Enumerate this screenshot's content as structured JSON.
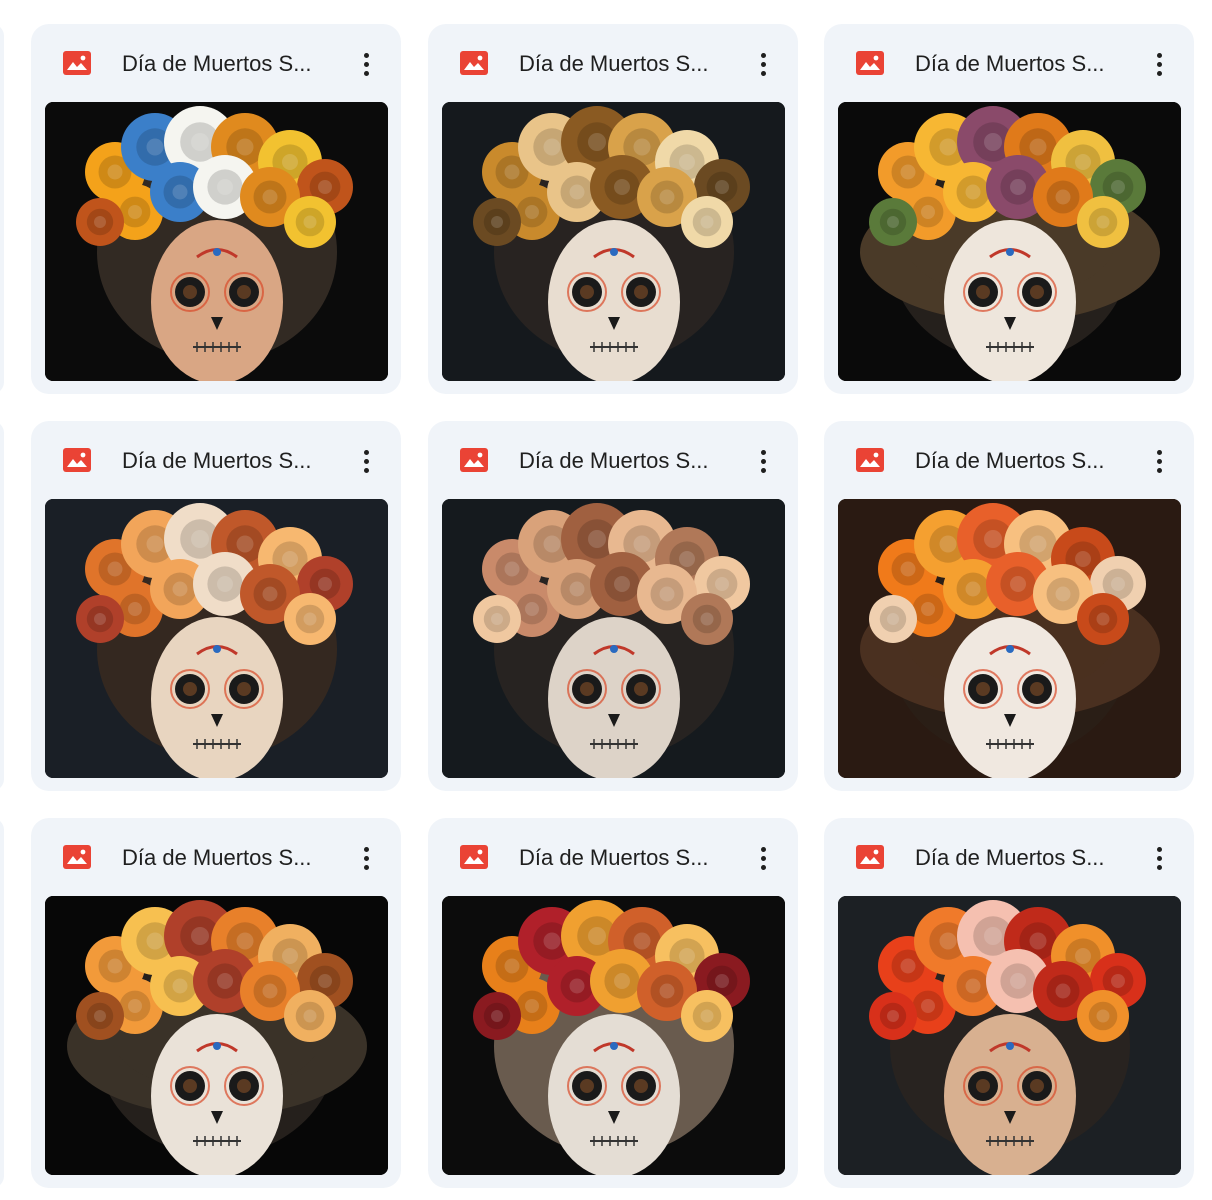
{
  "files": [
    {
      "title": "Día de Muertos S...",
      "icon": "image-file-icon",
      "palette": {
        "bg": "#0b0b0b",
        "hat": null,
        "flowers": [
          "#f4a21a",
          "#3b7fc9",
          "#f5f5f0",
          "#e08a1e",
          "#f2c230",
          "#c0541b"
        ],
        "face": "#d9a684",
        "hair": "#3a3028"
      }
    },
    {
      "title": "Día de Muertos S...",
      "icon": "image-file-icon",
      "palette": {
        "bg": "#15191d",
        "hat": null,
        "flowers": [
          "#c98a2c",
          "#e9c489",
          "#8a5a22",
          "#d9a24a",
          "#f0d9a8",
          "#6b4a22"
        ],
        "face": "#e8ddd0",
        "hair": "#2c2622"
      }
    },
    {
      "title": "Día de Muertos S...",
      "icon": "image-file-icon",
      "palette": {
        "bg": "#0a0a0a",
        "hat": "#4a3a28",
        "flowers": [
          "#f29b2a",
          "#f7b733",
          "#8a4a6a",
          "#e07a1a",
          "#f0c040",
          "#5a7a3a"
        ],
        "face": "#eee6dc",
        "hair": "#2a2420"
      }
    },
    {
      "title": "Día de Muertos S...",
      "icon": "image-file-icon",
      "palette": {
        "bg": "#1a1f26",
        "hat": null,
        "flowers": [
          "#e0742a",
          "#f2a55a",
          "#f0ddc8",
          "#c0582a",
          "#f7b870",
          "#b0402a"
        ],
        "face": "#e8d5c0",
        "hair": "#3a2a20"
      }
    },
    {
      "title": "Día de Muertos S...",
      "icon": "image-file-icon",
      "palette": {
        "bg": "#151a1e",
        "hat": null,
        "flowers": [
          "#c98a6a",
          "#d9a27a",
          "#a06040",
          "#e8b890",
          "#b07858",
          "#f0c8a0"
        ],
        "face": "#ddd3c8",
        "hair": "#2a2622"
      }
    },
    {
      "title": "Día de Muertos S...",
      "icon": "image-file-icon",
      "palette": {
        "bg": "#2a1a12",
        "hat": "#4a3020",
        "flowers": [
          "#f07a1a",
          "#f5a030",
          "#e8602a",
          "#f7c080",
          "#c84a1a",
          "#f0d0b0"
        ],
        "face": "#f0e8e0",
        "hair": "#2a2018"
      }
    },
    {
      "title": "Día de Muertos S...",
      "icon": "image-file-icon",
      "palette": {
        "bg": "#070707",
        "hat": "#3a3228",
        "flowers": [
          "#f29a3a",
          "#f7c050",
          "#b0402a",
          "#e8802a",
          "#f0b060",
          "#a05020"
        ],
        "face": "#eae2d8",
        "hair": "#2a2420"
      }
    },
    {
      "title": "Día de Muertos S...",
      "icon": "image-file-icon",
      "palette": {
        "bg": "#0c0c0c",
        "hat": null,
        "flowers": [
          "#e8801a",
          "#b0202a",
          "#f0a030",
          "#d0602a",
          "#f7c060",
          "#8a1a20"
        ],
        "face": "#e4ddd4",
        "hair": "#7a6a5a"
      }
    },
    {
      "title": "Día de Muertos S...",
      "icon": "image-file-icon",
      "palette": {
        "bg": "#1c2024",
        "hat": null,
        "flowers": [
          "#e8401a",
          "#f07a2a",
          "#f5c0b0",
          "#c02a1a",
          "#f0902a",
          "#d8301a"
        ],
        "face": "#d8b090",
        "hair": "#2a2420"
      }
    }
  ]
}
